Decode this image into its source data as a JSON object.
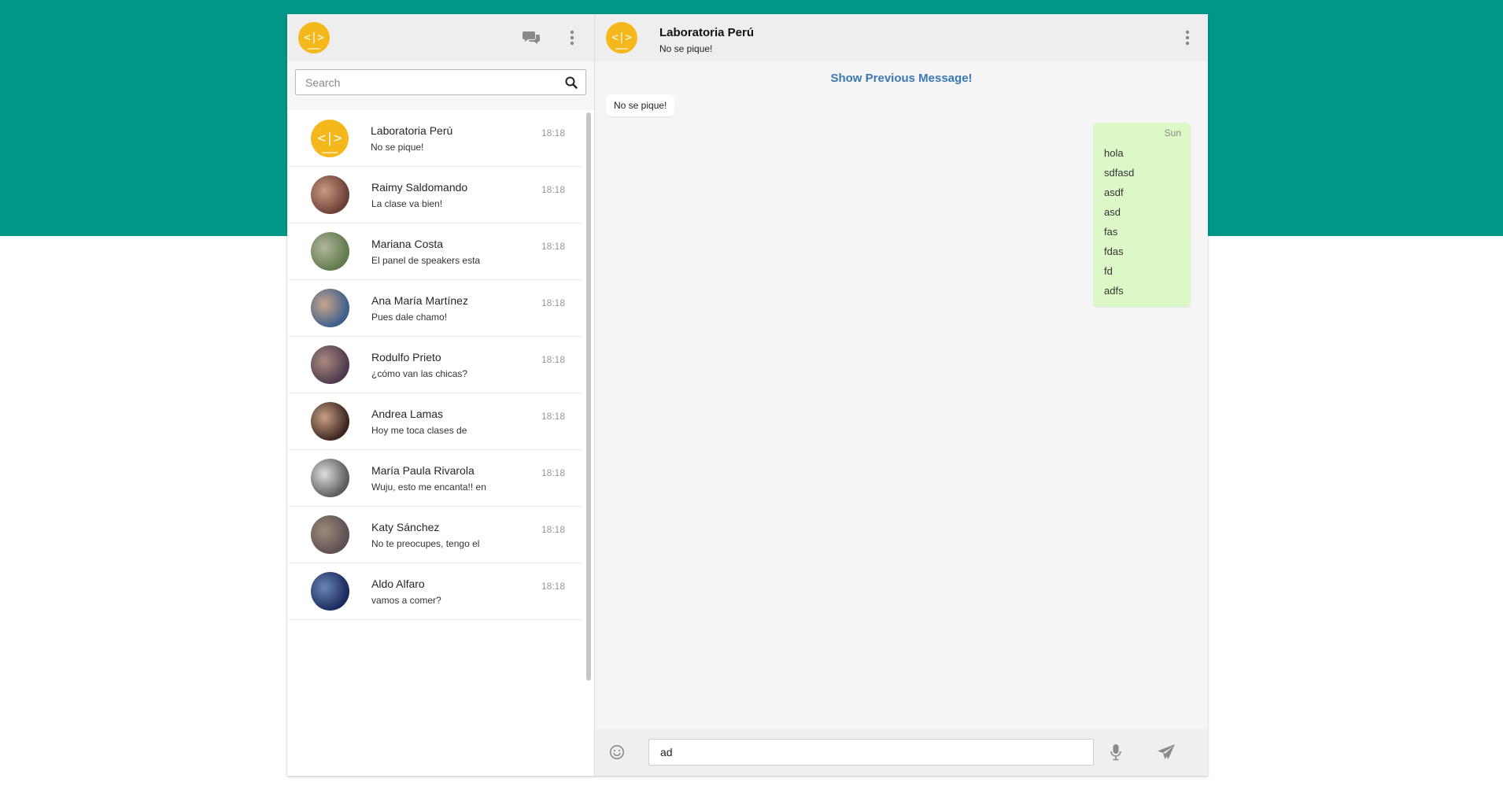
{
  "colors": {
    "brand_band": "#009688",
    "logo_yellow": "#f5b81c",
    "link_blue": "#3a78b4",
    "outgoing_bubble": "#dcf8c6"
  },
  "sidebar": {
    "header": {
      "avatar_text": "<|>",
      "icons": [
        "chat-icon",
        "menu-icon"
      ]
    },
    "search": {
      "placeholder": "Search",
      "value": ""
    },
    "chats": [
      {
        "name": "Laboratoria Perú",
        "preview": "No se pique!",
        "time": "18:18",
        "avatar": "logo",
        "colors": [
          "#f5b81c",
          "#f5b81c"
        ]
      },
      {
        "name": "Raimy Saldomando",
        "preview": "La clase va bien!",
        "time": "18:18",
        "avatar": "photo",
        "colors": [
          "#6b3f36",
          "#c89a82"
        ]
      },
      {
        "name": "Mariana Costa",
        "preview": "El panel de speakers esta",
        "time": "18:18",
        "avatar": "photo",
        "colors": [
          "#5f7a4b",
          "#b2b59c"
        ]
      },
      {
        "name": "Ana María Martínez",
        "preview": "Pues dale chamo!",
        "time": "18:18",
        "avatar": "photo",
        "colors": [
          "#3d5f8c",
          "#c8a68a"
        ]
      },
      {
        "name": "Rodulfo Prieto",
        "preview": "¿cómo van las chicas?",
        "time": "18:18",
        "avatar": "photo",
        "colors": [
          "#4e3a4d",
          "#a98a7f"
        ]
      },
      {
        "name": "Andrea Lamas",
        "preview": "Hoy me toca clases de",
        "time": "18:18",
        "avatar": "photo",
        "colors": [
          "#3b2620",
          "#c99f84"
        ]
      },
      {
        "name": "María Paula Rivarola",
        "preview": "Wuju, esto me encanta!! en",
        "time": "18:18",
        "avatar": "photo",
        "colors": [
          "#5b5b5b",
          "#dedede"
        ]
      },
      {
        "name": "Katy Sánchez",
        "preview": "No te preocupes, tengo el",
        "time": "18:18",
        "avatar": "photo",
        "colors": [
          "#5d4f52",
          "#9c8a7a"
        ]
      },
      {
        "name": "Aldo Alfaro",
        "preview": "vamos a comer?",
        "time": "18:18",
        "avatar": "photo",
        "colors": [
          "#1a2a5c",
          "#6a84b8"
        ]
      }
    ]
  },
  "chat": {
    "header": {
      "avatar_text": "<|>",
      "title": "Laboratoria Perú",
      "subtitle": "No se pique!"
    },
    "show_previous": "Show Previous Message!",
    "incoming": {
      "text": "No se pique!"
    },
    "outgoing": {
      "stamp": "Sun",
      "lines": [
        "hola",
        "sdfasd",
        "asdf",
        "asd",
        "fas",
        "fdas",
        "fd",
        "adfs"
      ]
    },
    "composer": {
      "value": "ad",
      "icons": [
        "emoji-icon",
        "mic-icon",
        "send-icon"
      ]
    }
  }
}
